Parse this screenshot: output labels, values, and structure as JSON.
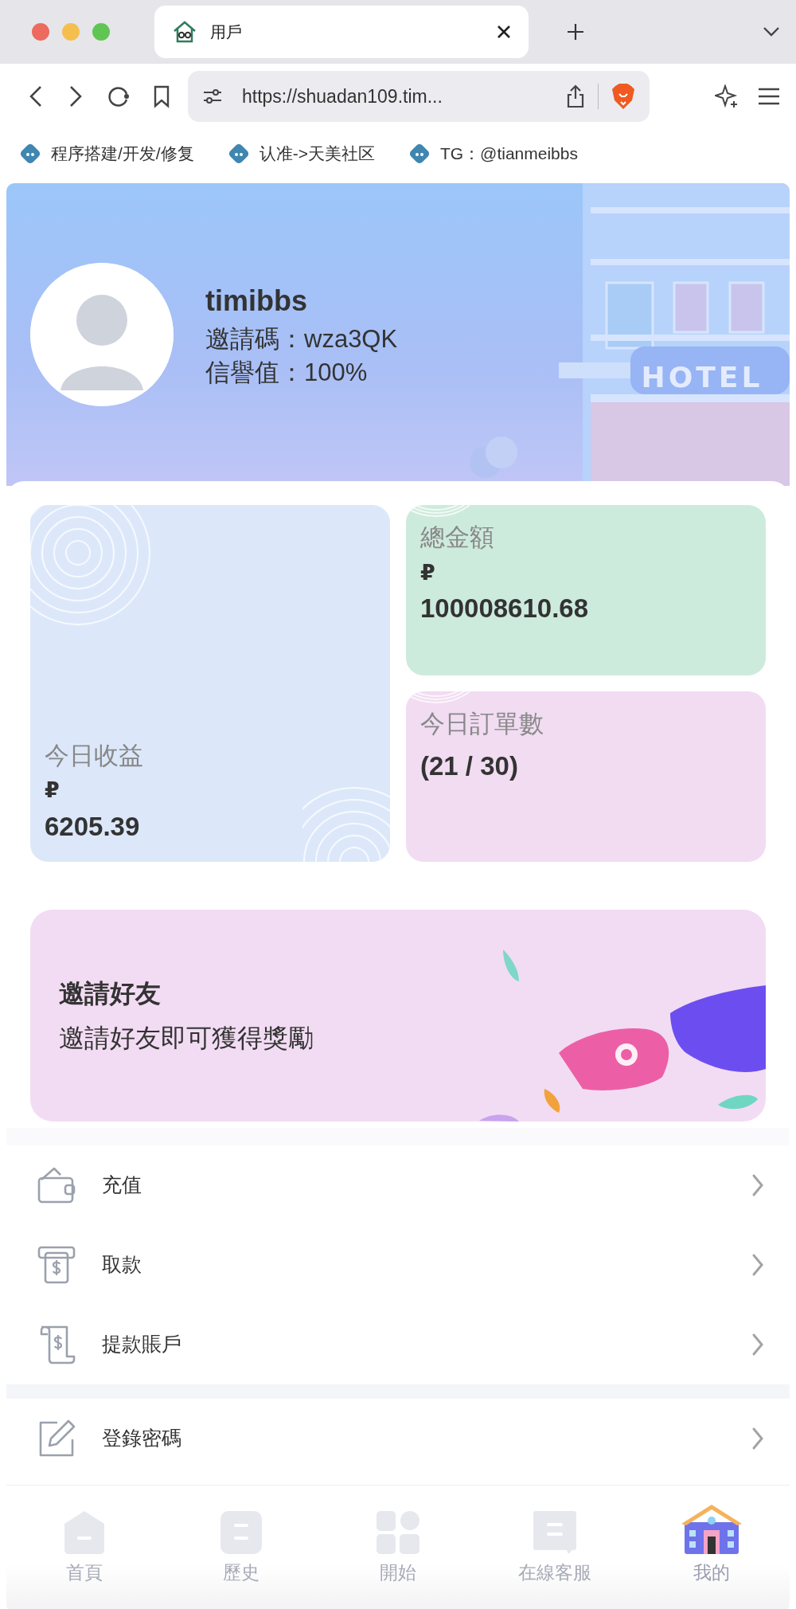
{
  "browser": {
    "tab_title": "用戶",
    "url": "https://shuadan109.tim...",
    "bookmarks": [
      {
        "label": "程序搭建/开发/修复"
      },
      {
        "label": "认准->天美社区"
      },
      {
        "label": "TG：@tianmeibbs"
      }
    ]
  },
  "profile": {
    "username": "timibbs",
    "invite_code": "邀請碼：wza3QK",
    "credit": "信譽值：100%",
    "sign": "HOTEL"
  },
  "stats": [
    {
      "label": "今日收益",
      "currency": "₽",
      "value": "6205.39",
      "color": "#dce8fa"
    },
    {
      "label": "總金額",
      "currency": "₽",
      "value": "100008610.68",
      "color": "#cdebdd"
    },
    {
      "label": "今日訂單數",
      "value": "(21 / 30)",
      "color": "#f1dcf2"
    }
  ],
  "invite": {
    "title": "邀請好友",
    "subtitle": "邀請好友即可獲得獎勵"
  },
  "menu_groups": [
    {
      "items": [
        {
          "label": "充值"
        },
        {
          "label": "取款"
        },
        {
          "label": "提款賬戶"
        }
      ]
    },
    {
      "items": [
        {
          "label": "登錄密碼"
        }
      ]
    }
  ],
  "nav": [
    {
      "label": "首頁",
      "selected": false
    },
    {
      "label": "歷史",
      "selected": false
    },
    {
      "label": "開始",
      "selected": false
    },
    {
      "label": "在線客服",
      "selected": false
    },
    {
      "label": "我的",
      "selected": true
    }
  ]
}
